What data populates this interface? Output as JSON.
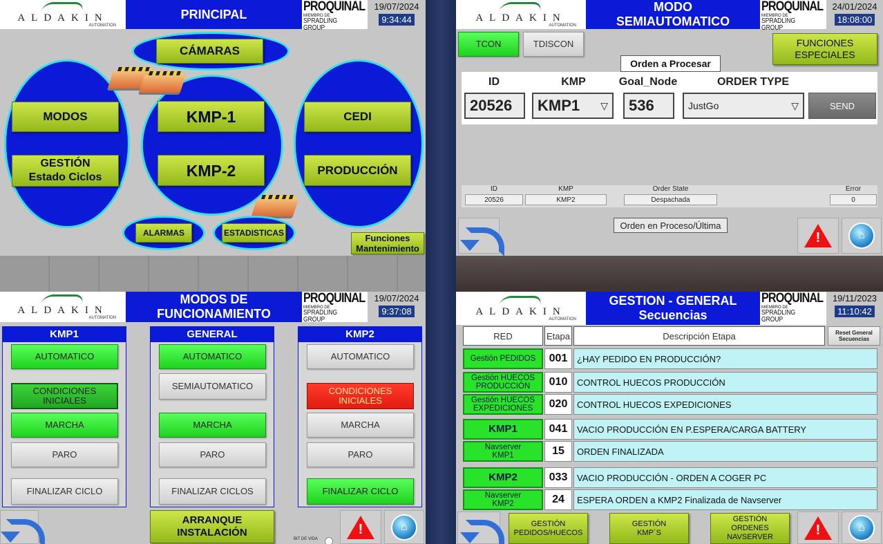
{
  "colors": {
    "header_blue": "#0a1ad6",
    "oval_border": "#33e0ea",
    "lime": "#b4d334",
    "green_on": "#33f033",
    "red_alarm": "#ee2211",
    "cyan_row": "#bff3f6"
  },
  "logo": {
    "name": "ALDAKIN",
    "sub": "AUTOMATION"
  },
  "brand": {
    "name": "PROQUINAL",
    "member": "MIEMBRO DE",
    "group": "SPRADLING GROUP"
  },
  "principal": {
    "title": "PRINCIPAL",
    "date": "19/07/2024",
    "time": "9:34:44",
    "camaras": "CÁMARAS",
    "modos": "MODOS",
    "gestion": "GESTIÓN\nEstado Ciclos",
    "kmp1": "KMP-1",
    "kmp2": "KMP-2",
    "cedi": "CEDI",
    "produccion": "PRODUCCIÓN",
    "alarmas": "ALARMAS",
    "estadisticas": "ESTADISTICAS",
    "funciones": "Funciones\nMantenimiento"
  },
  "semi": {
    "title": "MODO\nSEMIAUTOMATICO",
    "date": "24/01/2024",
    "time": "18:08:00",
    "tcon": "TCON",
    "tdiscon": "TDISCON",
    "funciones": "FUNCIONES\nESPECIALES",
    "orden_label": "Orden a Procesar",
    "col_id": "ID",
    "col_kmp": "KMP",
    "col_goal": "Goal_Node",
    "col_type": "ORDER TYPE",
    "id_value": "20526",
    "kmp_value": "KMP1",
    "goal_value": "536",
    "type_value": "JustGo",
    "send": "SEND",
    "s_id_label": "ID",
    "s_kmp_label": "KMP",
    "s_state_label": "Order State",
    "s_error_label": "Error",
    "s_id": "20526",
    "s_kmp": "KMP2",
    "s_state": "Despachada",
    "s_error": "0",
    "orden_proceso": "Orden en Proceso/Última"
  },
  "modos": {
    "title": "MODOS DE\nFUNCIONAMIENTO",
    "date": "19/07/2024",
    "time": "9:37:08",
    "col1": "KMP1",
    "col2": "GENERAL",
    "col3": "KMP2",
    "k1": [
      "AUTOMATICO",
      "CONDICIONES\nINICIALES",
      "MARCHA",
      "PARO",
      "FINALIZAR CICLO"
    ],
    "g": [
      "AUTOMATICO",
      "SEMIAUTOMATICO",
      "MARCHA",
      "PARO",
      "FINALIZAR CICLOS"
    ],
    "k2": [
      "AUTOMATICO",
      "CONDICIONES\nINICIALES",
      "MARCHA",
      "PARO",
      "FINALIZAR CICLO"
    ],
    "arranque": "ARRANQUE\nINSTALACIÓN",
    "bit": "BIT DE VIDA"
  },
  "gestion": {
    "title": "GESTION - GENERAL\nSecuencias",
    "date": "19/11/2023",
    "time": "11:10:42",
    "h_red": "RED",
    "h_etapa": "Etapa",
    "h_desc": "Descripción Etapa",
    "reset": "Reset General\nSecuencias",
    "rows": [
      {
        "name": "Gestión PEDIDOS",
        "num": "001",
        "desc": "¿HAY PEDIDO EN PRODUCCIÓN?"
      },
      {
        "name": "Gestión HUECOS\nPRODUCCIÓN",
        "num": "010",
        "desc": "CONTROL HUECOS PRODUCCIÓN"
      },
      {
        "name": "Gestión HUECOS\nEXPEDICIONES",
        "num": "020",
        "desc": "CONTROL HUECOS EXPEDICIONES"
      },
      {
        "name": "KMP1",
        "num": "041",
        "desc": "VACIO PRODUCCIÓN EN P.ESPERA/CARGA BATTERY"
      },
      {
        "name": "Navserver\nKMP1",
        "num": "15",
        "desc": "ORDEN FINALIZADA"
      },
      {
        "name": "KMP2",
        "num": "033",
        "desc": "VACIO PRODUCCIÓN - ORDEN A COGER PC"
      },
      {
        "name": "Navserver\nKMP2",
        "num": "24",
        "desc": "ESPERA ORDEN a KMP2 Finalizada de Navserver"
      }
    ],
    "b1": "GESTIÓN\nPEDIDOS/HUECOS",
    "b2": "GESTIÓN\nKMP´S",
    "b3": "GESTIÓN\nORDENES\nNAVSERVER"
  }
}
